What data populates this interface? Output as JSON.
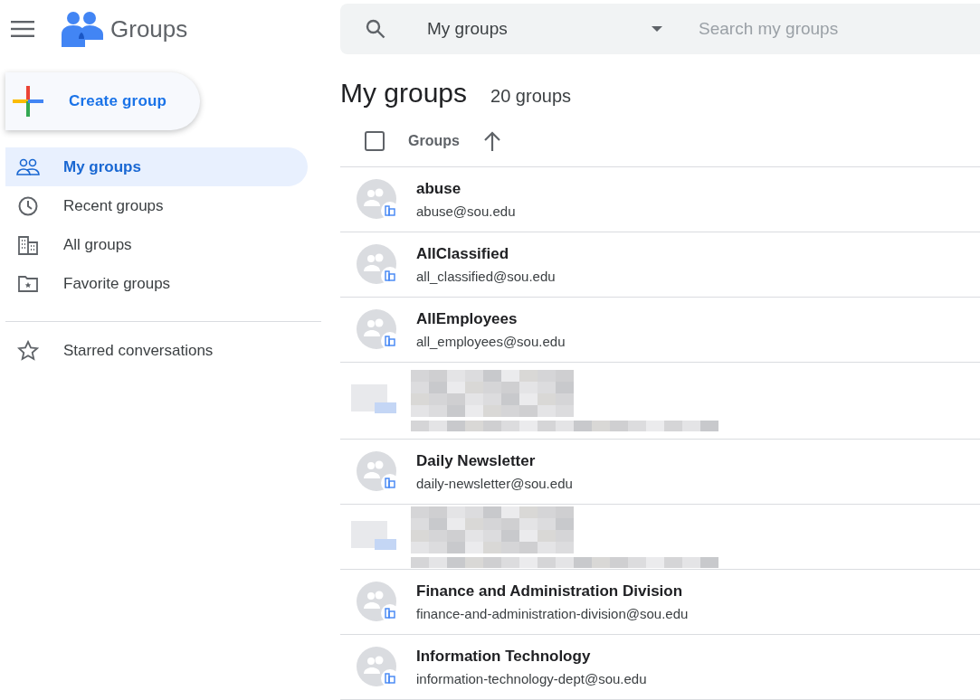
{
  "app": {
    "title": "Groups"
  },
  "create_button": {
    "label": "Create group"
  },
  "sidebar": {
    "items": [
      {
        "label": "My groups",
        "selected": true
      },
      {
        "label": "Recent groups",
        "selected": false
      },
      {
        "label": "All groups",
        "selected": false
      },
      {
        "label": "Favorite groups",
        "selected": false
      }
    ],
    "secondary_items": [
      {
        "label": "Starred conversations",
        "selected": false
      }
    ]
  },
  "search": {
    "scope": "My groups",
    "placeholder": "Search my groups"
  },
  "page": {
    "title": "My groups",
    "count": "20 groups"
  },
  "table": {
    "select_all": {
      "checked": false
    },
    "column": "Groups",
    "rows": [
      {
        "kind": "group",
        "name": "abuse",
        "email": "abuse@sou.edu"
      },
      {
        "kind": "group",
        "name": "AllClassified",
        "email": "all_classified@sou.edu"
      },
      {
        "kind": "group",
        "name": "AllEmployees",
        "email": "all_employees@sou.edu"
      },
      {
        "kind": "redacted"
      },
      {
        "kind": "group",
        "name": "Daily Newsletter",
        "email": "daily-newsletter@sou.edu"
      },
      {
        "kind": "redacted"
      },
      {
        "kind": "group",
        "name": "Finance and Administration Division",
        "email": "finance-and-administration-division@sou.edu"
      },
      {
        "kind": "group",
        "name": "Information Technology",
        "email": "information-technology-dept@sou.edu"
      }
    ]
  }
}
